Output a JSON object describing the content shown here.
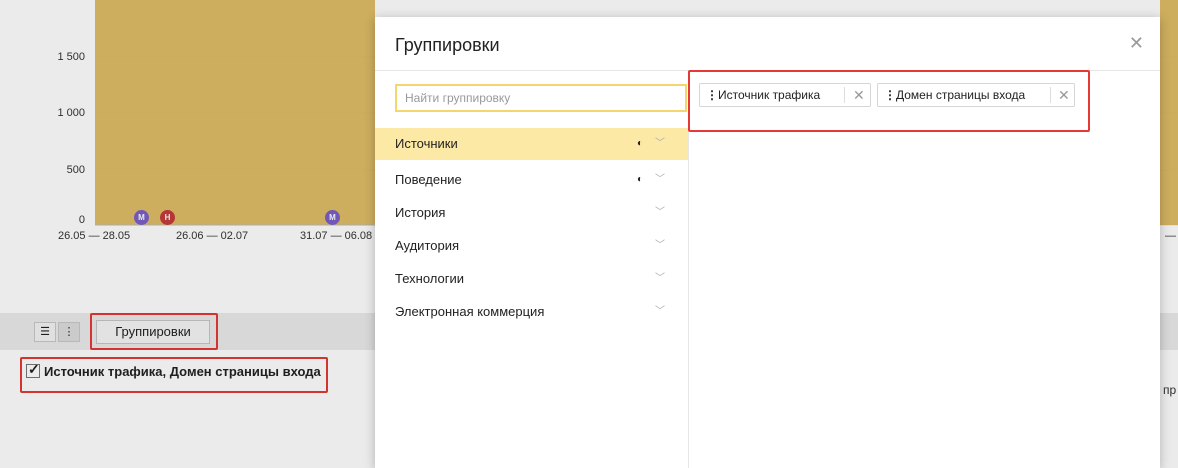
{
  "chart": {
    "y_ticks": [
      "1 500",
      "1 000",
      "500",
      "0"
    ],
    "x_ticks": [
      "26.05 — 28.05",
      "26.06 — 02.07",
      "31.07 — 06.08"
    ],
    "right_edge_tick": "—",
    "fill_color": "#d9b24c",
    "markers": [
      "М",
      "Н",
      "М"
    ]
  },
  "toolbar": {
    "list_view_icon": "list-icon",
    "tree_view_icon": "tree-icon",
    "groupings_label": "Группировки"
  },
  "applied_groupings": {
    "label": "Источник трафика, Домен страницы входа",
    "checked": true
  },
  "right_clip": {
    "text": "пр"
  },
  "modal": {
    "title": "Группировки",
    "close_icon": "close-icon",
    "search_placeholder": "Найти группировку",
    "categories": [
      {
        "label": "Источники",
        "indicator": "◐",
        "active": true
      },
      {
        "label": "Поведение",
        "indicator": "◐",
        "active": false
      },
      {
        "label": "История",
        "indicator": "",
        "active": false
      },
      {
        "label": "Аудитория",
        "indicator": "",
        "active": false
      },
      {
        "label": "Технологии",
        "indicator": "",
        "active": false
      },
      {
        "label": "Электронная коммерция",
        "indicator": "",
        "active": false
      }
    ],
    "selected": [
      {
        "label": "Источник трафика"
      },
      {
        "label": "Домен страницы входа"
      }
    ]
  },
  "colors": {
    "accent": "#fde9a6",
    "highlight_box": "#e53935",
    "chart_fill": "#d9b24c"
  }
}
